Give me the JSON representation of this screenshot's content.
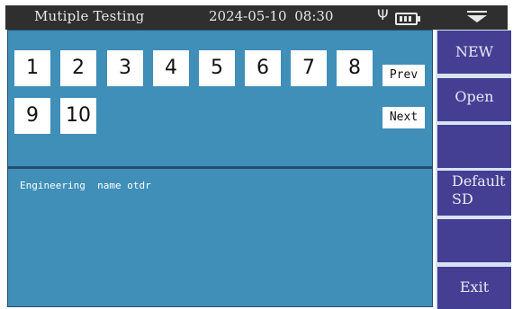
{
  "status_bar": {
    "title": "Mutiple Testing",
    "datetime": "2024-05-10   08:30",
    "usb_glyph": "Ψ",
    "icons": [
      "usb-icon",
      "battery-icon",
      "menu-dropdown-icon"
    ]
  },
  "pages": {
    "row1": [
      "1",
      "2",
      "3",
      "4",
      "5",
      "6",
      "7",
      "8"
    ],
    "row2": [
      "9",
      "10"
    ],
    "prev_label": "Prev",
    "next_label": "Next"
  },
  "project": {
    "label": "Engineering  name otdr"
  },
  "sidebar": {
    "new_label": "NEW",
    "open_label": "Open",
    "default_line1": "Default",
    "default_line2": "SD",
    "exit_label": "Exit"
  },
  "colors": {
    "panel": "#3f8fb8",
    "sidebar_button": "#453f94",
    "status_bar": "#2f2f2f"
  }
}
